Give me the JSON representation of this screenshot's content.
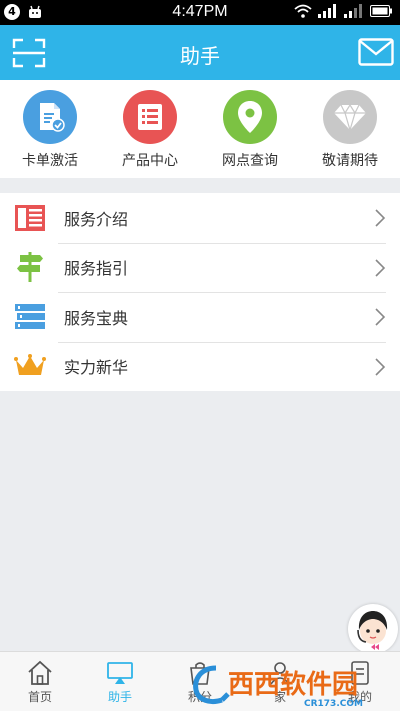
{
  "status_bar": {
    "notification_count": "4",
    "time": "4:47PM"
  },
  "header": {
    "title": "助手"
  },
  "quick_grid": [
    {
      "label": "卡单激活",
      "icon": "card-activate-icon",
      "color": "#4a9fe0"
    },
    {
      "label": "产品中心",
      "icon": "product-list-icon",
      "color": "#e85454"
    },
    {
      "label": "网点查询",
      "icon": "location-pin-icon",
      "color": "#7cc243"
    },
    {
      "label": "敬请期待",
      "icon": "diamond-icon",
      "color": "#c8c8c8"
    }
  ],
  "menu": [
    {
      "label": "服务介绍",
      "icon": "newspaper-icon"
    },
    {
      "label": "服务指引",
      "icon": "signpost-icon"
    },
    {
      "label": "服务宝典",
      "icon": "books-icon"
    },
    {
      "label": "实力新华",
      "icon": "crown-icon"
    }
  ],
  "tabs": [
    {
      "label": "首页",
      "icon": "home-icon",
      "active": false
    },
    {
      "label": "助手",
      "icon": "assistant-icon",
      "active": true
    },
    {
      "label": "积分",
      "icon": "points-icon",
      "active": false
    },
    {
      "label": "家",
      "icon": "family-icon",
      "active": false
    },
    {
      "label": "我的",
      "icon": "profile-icon",
      "active": false
    }
  ],
  "watermark": {
    "text": "西西软件园",
    "url": "CR173.COM"
  },
  "colors": {
    "accent": "#2fb4e8"
  }
}
